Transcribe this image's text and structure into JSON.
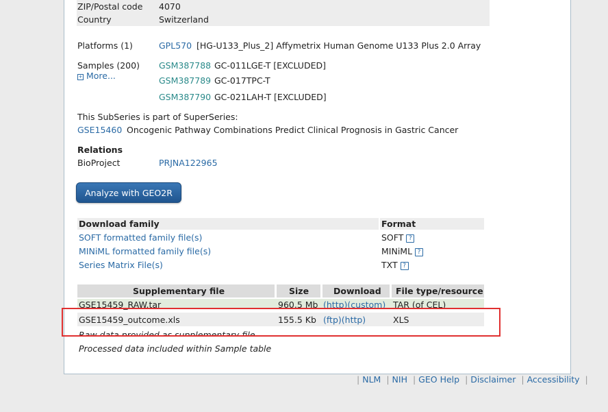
{
  "contact": {
    "zip_label": "ZIP/Postal code",
    "zip_value": "4070",
    "country_label": "Country",
    "country_value": "Switzerland"
  },
  "platforms": {
    "label": "Platforms (1)",
    "id": "GPL570",
    "desc": "[HG-U133_Plus_2] Affymetrix Human Genome U133 Plus 2.0 Array"
  },
  "samples": {
    "label": "Samples (200)",
    "more": "More...",
    "items": [
      {
        "id": "GSM387788",
        "desc": "GC-011LGE-T [EXCLUDED]"
      },
      {
        "id": "GSM387789",
        "desc": "GC-017TPC-T"
      },
      {
        "id": "GSM387790",
        "desc": "GC-021LAH-T [EXCLUDED]"
      }
    ]
  },
  "superseries": {
    "intro": "This SubSeries is part of SuperSeries:",
    "id": "GSE15460",
    "desc": "Oncogenic Pathway Combinations Predict Clinical Prognosis in Gastric Cancer"
  },
  "relations": {
    "heading": "Relations",
    "label": "BioProject",
    "value": "PRJNA122965"
  },
  "analyze_button": "Analyze with GEO2R",
  "download_family": {
    "col1": "Download family",
    "col2": "Format",
    "rows": [
      {
        "label": "SOFT formatted family file(s)",
        "format": "SOFT"
      },
      {
        "label": "MINiML formatted family file(s)",
        "format": "MINiML"
      },
      {
        "label": "Series Matrix File(s)",
        "format": "TXT"
      }
    ],
    "help_glyph": "?"
  },
  "supplementary": {
    "headers": [
      "Supplementary file",
      "Size",
      "Download",
      "File type/resource"
    ],
    "rows": [
      {
        "file": "GSE15459_RAW.tar",
        "size": "960.5 Mb",
        "download": "(http)(custom)",
        "type": "TAR (of CEL)"
      },
      {
        "file": "GSE15459_outcome.xls",
        "size": "155.5 Kb",
        "download": "(ftp)(http)",
        "type": "XLS"
      }
    ],
    "note1": "Raw data provided as supplementary file",
    "note2": "Processed data included within Sample table"
  },
  "footer": {
    "links": [
      "NLM",
      "NIH",
      "GEO Help",
      "Disclaimer",
      "Accessibility"
    ],
    "separator": "|"
  },
  "colors": {
    "link": "#2a6aa5",
    "sample_link": "#2a8a8a",
    "highlight_box": "#e03030",
    "button": "#2c64a0"
  }
}
